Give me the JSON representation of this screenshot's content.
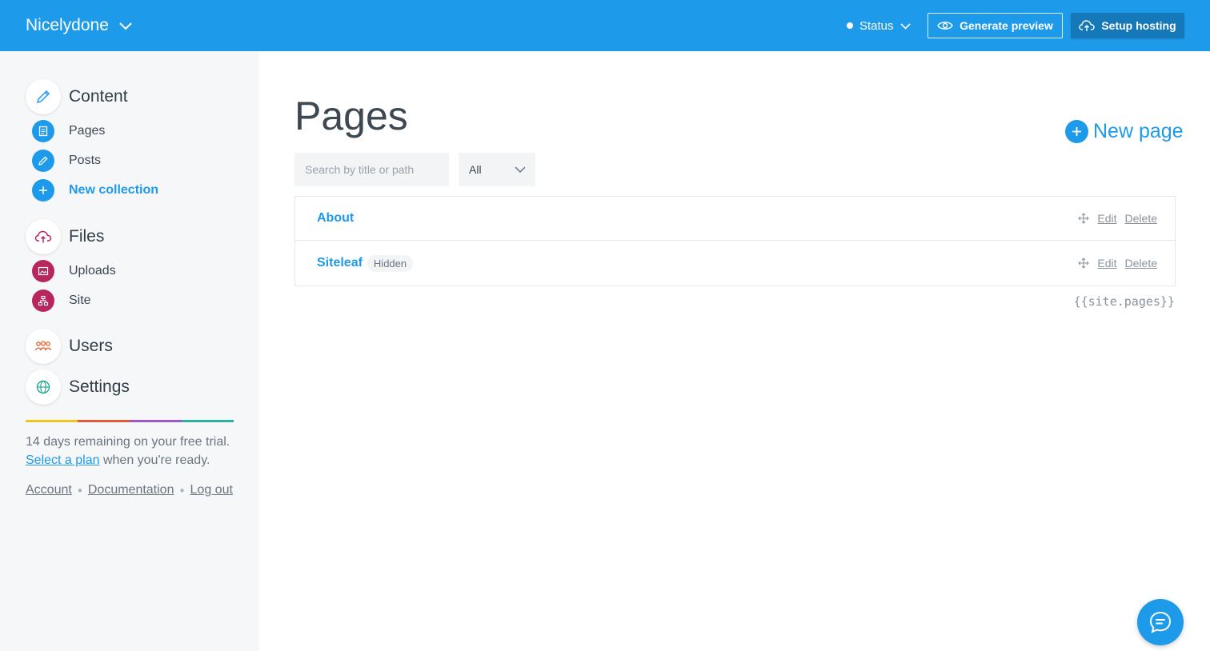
{
  "topbar": {
    "site_name": "Nicelydone",
    "status_label": "Status",
    "preview_label": "Generate preview",
    "hosting_label": "Setup hosting"
  },
  "sidebar": {
    "content": {
      "label": "Content",
      "items": [
        {
          "label": "Pages",
          "icon": "page-icon",
          "color": "#1e9aeb"
        },
        {
          "label": "Posts",
          "icon": "pencil-icon",
          "color": "#1e9aeb"
        },
        {
          "label": "New collection",
          "icon": "plus-icon",
          "color": "#1e9aeb"
        }
      ]
    },
    "files": {
      "label": "Files",
      "items": [
        {
          "label": "Uploads",
          "icon": "image-icon",
          "color": "#b7275e"
        },
        {
          "label": "Site",
          "icon": "sitemap-icon",
          "color": "#b7275e"
        }
      ]
    },
    "users": {
      "label": "Users",
      "icon": "users-icon",
      "color": "#e8693a"
    },
    "settings": {
      "label": "Settings",
      "icon": "globe-icon",
      "color": "#22a98f"
    },
    "rainbow_colors": [
      "#f0c419",
      "#e05a3b",
      "#9b59c9",
      "#2bb3a0"
    ],
    "trial": {
      "line1": "14 days remaining on your free trial.",
      "link": "Select a plan",
      "line2_rest": " when you're ready."
    },
    "footer": {
      "account": "Account",
      "docs": "Documentation",
      "logout": "Log out"
    }
  },
  "main": {
    "title": "Pages",
    "new_page_label": "New page",
    "search_placeholder": "Search by title or path",
    "filter_value": "All",
    "rows": [
      {
        "title": "About",
        "badge": "",
        "edit": "Edit",
        "delete": "Delete"
      },
      {
        "title": "Siteleaf",
        "badge": "Hidden",
        "edit": "Edit",
        "delete": "Delete"
      }
    ],
    "liquid_tag": "{{site.pages}}"
  },
  "colors": {
    "accent": "#1e9aeb",
    "hosting_button": "#1578b8",
    "sidebar_bg": "#f6f7f9"
  }
}
